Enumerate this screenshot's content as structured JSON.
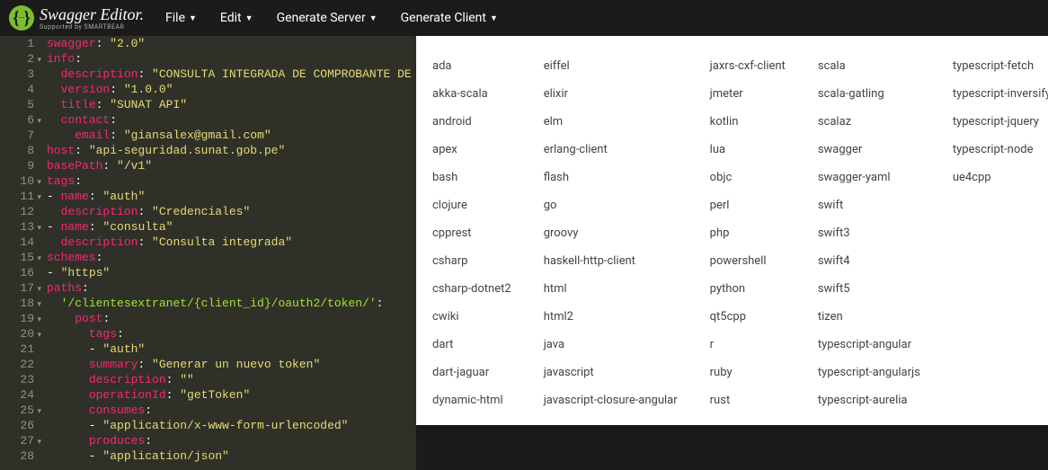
{
  "header": {
    "logo": "Swagger Editor.",
    "logo_sub": "Supported by SMARTBEAR",
    "menus": {
      "file": "File",
      "edit": "Edit",
      "gen_server": "Generate Server",
      "gen_client": "Generate Client"
    }
  },
  "editor": {
    "lines": [
      {
        "n": 1,
        "fold": "",
        "segs": [
          [
            "k",
            "swagger"
          ],
          [
            "p",
            ": "
          ],
          [
            "s",
            "\"2.0\""
          ]
        ]
      },
      {
        "n": 2,
        "fold": "▾",
        "segs": [
          [
            "k",
            "info"
          ],
          [
            "p",
            ":"
          ]
        ]
      },
      {
        "n": 3,
        "fold": "",
        "segs": [
          [
            "p",
            "  "
          ],
          [
            "k",
            "description"
          ],
          [
            "p",
            ": "
          ],
          [
            "s",
            "\"CONSULTA INTEGRADA DE COMPROBANTE DE"
          ]
        ]
      },
      {
        "n": 4,
        "fold": "",
        "segs": [
          [
            "p",
            "  "
          ],
          [
            "k",
            "version"
          ],
          [
            "p",
            ": "
          ],
          [
            "s",
            "\"1.0.0\""
          ]
        ]
      },
      {
        "n": 5,
        "fold": "",
        "segs": [
          [
            "p",
            "  "
          ],
          [
            "k",
            "title"
          ],
          [
            "p",
            ": "
          ],
          [
            "s",
            "\"SUNAT API\""
          ]
        ]
      },
      {
        "n": 6,
        "fold": "▾",
        "segs": [
          [
            "p",
            "  "
          ],
          [
            "k",
            "contact"
          ],
          [
            "p",
            ":"
          ]
        ]
      },
      {
        "n": 7,
        "fold": "",
        "segs": [
          [
            "p",
            "    "
          ],
          [
            "k",
            "email"
          ],
          [
            "p",
            ": "
          ],
          [
            "s",
            "\"giansalex@gmail.com\""
          ]
        ]
      },
      {
        "n": 8,
        "fold": "",
        "segs": [
          [
            "k",
            "host"
          ],
          [
            "p",
            ": "
          ],
          [
            "s",
            "\"api-seguridad.sunat.gob.pe\""
          ]
        ]
      },
      {
        "n": 9,
        "fold": "",
        "segs": [
          [
            "k",
            "basePath"
          ],
          [
            "p",
            ": "
          ],
          [
            "s",
            "\"/v1\""
          ]
        ]
      },
      {
        "n": 10,
        "fold": "▾",
        "segs": [
          [
            "k",
            "tags"
          ],
          [
            "p",
            ":"
          ]
        ]
      },
      {
        "n": 11,
        "fold": "▾",
        "segs": [
          [
            "p",
            "- "
          ],
          [
            "k",
            "name"
          ],
          [
            "p",
            ": "
          ],
          [
            "s",
            "\"auth\""
          ]
        ]
      },
      {
        "n": 12,
        "fold": "",
        "segs": [
          [
            "p",
            "  "
          ],
          [
            "k",
            "description"
          ],
          [
            "p",
            ": "
          ],
          [
            "s",
            "\"Credenciales\""
          ]
        ]
      },
      {
        "n": 13,
        "fold": "▾",
        "segs": [
          [
            "p",
            "- "
          ],
          [
            "k",
            "name"
          ],
          [
            "p",
            ": "
          ],
          [
            "s",
            "\"consulta\""
          ]
        ]
      },
      {
        "n": 14,
        "fold": "",
        "segs": [
          [
            "p",
            "  "
          ],
          [
            "k",
            "description"
          ],
          [
            "p",
            ": "
          ],
          [
            "s",
            "\"Consulta integrada\""
          ]
        ]
      },
      {
        "n": 15,
        "fold": "▾",
        "segs": [
          [
            "k",
            "schemes"
          ],
          [
            "p",
            ":"
          ]
        ]
      },
      {
        "n": 16,
        "fold": "",
        "segs": [
          [
            "p",
            "- "
          ],
          [
            "s",
            "\"https\""
          ]
        ]
      },
      {
        "n": 17,
        "fold": "▾",
        "segs": [
          [
            "k",
            "paths"
          ],
          [
            "p",
            ":"
          ]
        ]
      },
      {
        "n": 18,
        "fold": "▾",
        "segs": [
          [
            "p",
            "  "
          ],
          [
            "a",
            "'/clientesextranet/{client_id}/oauth2/token/'"
          ],
          [
            "p",
            ":"
          ]
        ]
      },
      {
        "n": 19,
        "fold": "▾",
        "segs": [
          [
            "p",
            "    "
          ],
          [
            "k",
            "post"
          ],
          [
            "p",
            ":"
          ]
        ]
      },
      {
        "n": 20,
        "fold": "▾",
        "segs": [
          [
            "p",
            "      "
          ],
          [
            "k",
            "tags"
          ],
          [
            "p",
            ":"
          ]
        ]
      },
      {
        "n": 21,
        "fold": "",
        "segs": [
          [
            "p",
            "      - "
          ],
          [
            "s",
            "\"auth\""
          ]
        ]
      },
      {
        "n": 22,
        "fold": "",
        "segs": [
          [
            "p",
            "      "
          ],
          [
            "k",
            "summary"
          ],
          [
            "p",
            ": "
          ],
          [
            "s",
            "\"Generar un nuevo token\""
          ]
        ]
      },
      {
        "n": 23,
        "fold": "",
        "segs": [
          [
            "p",
            "      "
          ],
          [
            "k",
            "description"
          ],
          [
            "p",
            ": "
          ],
          [
            "s",
            "\"\""
          ]
        ]
      },
      {
        "n": 24,
        "fold": "",
        "segs": [
          [
            "p",
            "      "
          ],
          [
            "k",
            "operationId"
          ],
          [
            "p",
            ": "
          ],
          [
            "s",
            "\"getToken\""
          ]
        ]
      },
      {
        "n": 25,
        "fold": "▾",
        "segs": [
          [
            "p",
            "      "
          ],
          [
            "k",
            "consumes"
          ],
          [
            "p",
            ":"
          ]
        ]
      },
      {
        "n": 26,
        "fold": "",
        "segs": [
          [
            "p",
            "      - "
          ],
          [
            "s",
            "\"application/x-www-form-urlencoded\""
          ]
        ]
      },
      {
        "n": 27,
        "fold": "▾",
        "segs": [
          [
            "p",
            "      "
          ],
          [
            "k",
            "produces"
          ],
          [
            "p",
            ":"
          ]
        ]
      },
      {
        "n": 28,
        "fold": "",
        "segs": [
          [
            "p",
            "      - "
          ],
          [
            "s",
            "\"application/json\""
          ]
        ]
      }
    ]
  },
  "dropdown": {
    "items": [
      "ada",
      "akka-scala",
      "android",
      "apex",
      "bash",
      "clojure",
      "cpprest",
      "csharp",
      "csharp-dotnet2",
      "cwiki",
      "dart",
      "dart-jaguar",
      "dynamic-html",
      "eiffel",
      "elixir",
      "elm",
      "erlang-client",
      "flash",
      "go",
      "groovy",
      "haskell-http-client",
      "html",
      "html2",
      "java",
      "javascript",
      "javascript-closure-angular",
      "jaxrs-cxf-client",
      "jmeter",
      "kotlin",
      "lua",
      "objc",
      "perl",
      "php",
      "powershell",
      "python",
      "qt5cpp",
      "r",
      "ruby",
      "rust",
      "scala",
      "scala-gatling",
      "scalaz",
      "swagger",
      "swagger-yaml",
      "swift",
      "swift3",
      "swift4",
      "swift5",
      "tizen",
      "typescript-angular",
      "typescript-angularjs",
      "typescript-aurelia",
      "typescript-fetch",
      "typescript-inversify",
      "typescript-jquery",
      "typescript-node",
      "ue4cpp"
    ]
  }
}
